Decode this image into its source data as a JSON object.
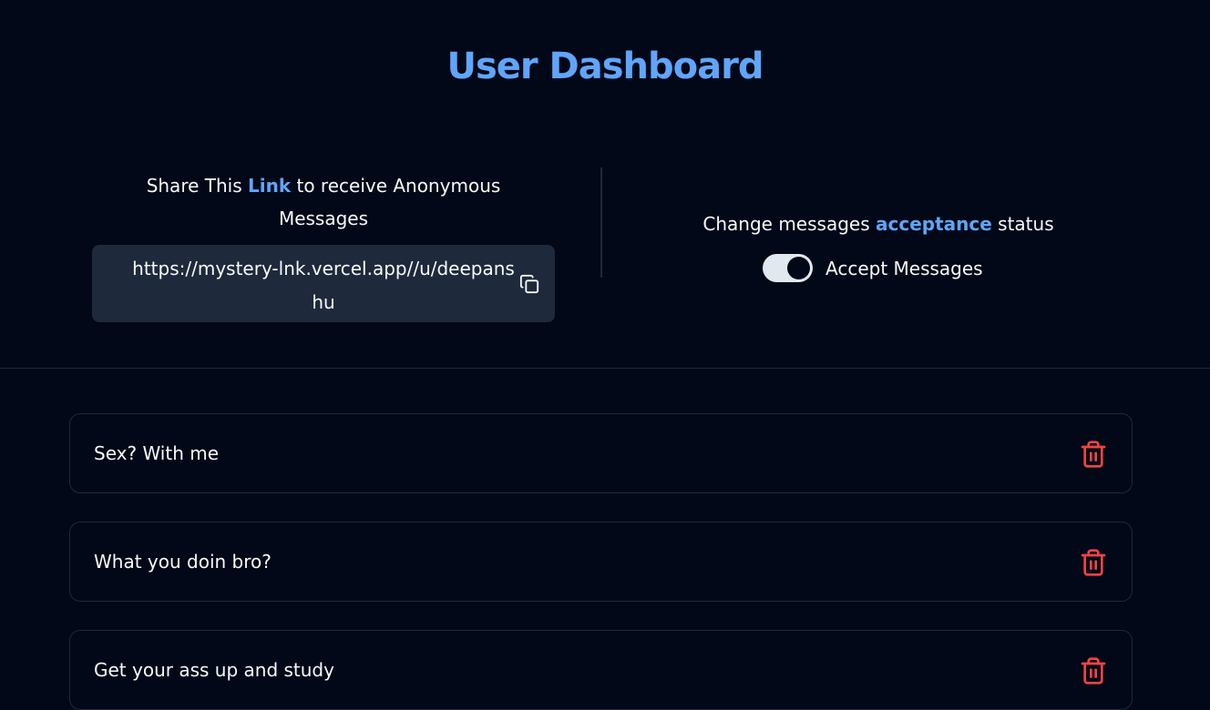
{
  "page": {
    "title": "User Dashboard"
  },
  "share": {
    "prefix": "Share This ",
    "link_word": "Link",
    "suffix": " to receive Anonymous Messages",
    "url": "https://mystery-lnk.vercel.app//u/deepanshu",
    "copy_icon": "copy-icon"
  },
  "status": {
    "prefix": "Change messages ",
    "accent_word": "acceptance",
    "suffix": " status",
    "toggle_label": "Accept Messages",
    "toggle_on": true
  },
  "messages": [
    {
      "text": "Sex? With me",
      "delete_icon": "trash-icon"
    },
    {
      "text": "What you doin bro?",
      "delete_icon": "trash-icon"
    },
    {
      "text": "Get your ass up and study",
      "delete_icon": "trash-icon"
    }
  ],
  "colors": {
    "background": "#020817",
    "accent": "#60a5fa",
    "card_border": "#1e293b",
    "link_box": "#1e293b",
    "danger": "#ef4444",
    "text": "#f8fafc"
  }
}
